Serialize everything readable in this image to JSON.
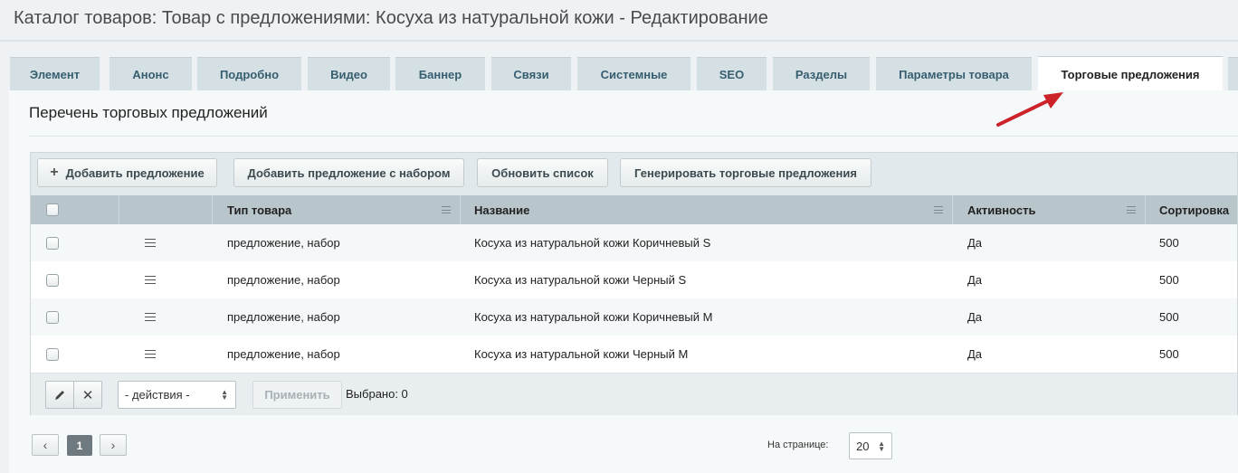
{
  "page_title": "Каталог товаров: Товар с предложениями: Косуха из натуральной кожи - Редактирование",
  "tabs": [
    {
      "label": "Элемент",
      "active": false
    },
    {
      "label": "Анонс",
      "active": false
    },
    {
      "label": "Подробно",
      "active": false
    },
    {
      "label": "Видео",
      "active": false
    },
    {
      "label": "Баннер",
      "active": false
    },
    {
      "label": "Связи",
      "active": false
    },
    {
      "label": "Системные",
      "active": false
    },
    {
      "label": "SEO",
      "active": false
    },
    {
      "label": "Разделы",
      "active": false
    },
    {
      "label": "Параметры товара",
      "active": false
    },
    {
      "label": "Торговые предложения",
      "active": true
    }
  ],
  "section_title": "Перечень торговых предложений",
  "toolbar": {
    "add_offer": "Добавить предложение",
    "add_offer_set": "Добавить предложение с набором",
    "refresh": "Обновить список",
    "generate": "Генерировать торговые предложения"
  },
  "columns": {
    "type": "Тип товара",
    "name": "Название",
    "active": "Активность",
    "sort": "Сортировка"
  },
  "rows": [
    {
      "type": "предложение, набор",
      "name": "Косуха из натуральной кожи Коричневый S",
      "active": "Да",
      "sort": "500"
    },
    {
      "type": "предложение, набор",
      "name": "Косуха из натуральной кожи Черный S",
      "active": "Да",
      "sort": "500"
    },
    {
      "type": "предложение, набор",
      "name": "Косуха из натуральной кожи Коричневый M",
      "active": "Да",
      "sort": "500"
    },
    {
      "type": "предложение, набор",
      "name": "Косуха из натуральной кожи Черный M",
      "active": "Да",
      "sort": "500"
    }
  ],
  "footer": {
    "actions_select": "- действия -",
    "apply": "Применить",
    "selected": "Выбрано: 0"
  },
  "pagination": {
    "current_page": "1",
    "per_page_label": "На странице:",
    "per_page_value": "20"
  },
  "colors": {
    "accent_arrow": "#cc2229",
    "header_bg": "#b8c6cb",
    "tab_bg": "#d5e0e5"
  }
}
